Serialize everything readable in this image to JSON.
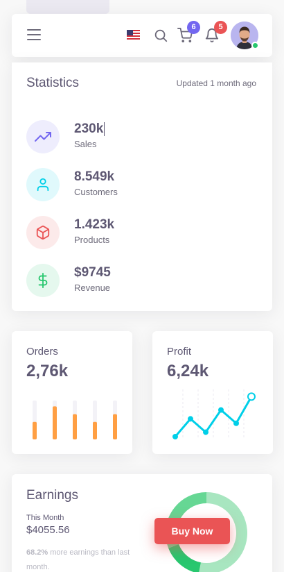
{
  "navbar": {
    "cart_count": "6",
    "notification_count": "5",
    "colors": {
      "cart_badge": "#7367f0",
      "notification_badge": "#ea5455",
      "online": "#28c76f"
    }
  },
  "statistics": {
    "title": "Statistics",
    "updated": "Updated 1 month ago",
    "items": [
      {
        "value": "230k",
        "label": "Sales",
        "icon": "trending-up-icon",
        "color": "#7367f0",
        "bg": "#eeedfd"
      },
      {
        "value": "8.549k",
        "label": "Customers",
        "icon": "user-icon",
        "color": "#00cfe8",
        "bg": "#e0f9fc"
      },
      {
        "value": "1.423k",
        "label": "Products",
        "icon": "box-icon",
        "color": "#ea5455",
        "bg": "#fceaea"
      },
      {
        "value": "$9745",
        "label": "Revenue",
        "icon": "dollar-icon",
        "color": "#28c76f",
        "bg": "#e5f8ee"
      }
    ]
  },
  "orders": {
    "title": "Orders",
    "value": "2,76k",
    "bar_levels": [
      0.45,
      0.85,
      0.65,
      0.45,
      0.65
    ],
    "colors": {
      "bar": "#ff9f43",
      "track": "#f3f2f7"
    }
  },
  "profit": {
    "title": "Profit",
    "value": "6,24k",
    "line_points": [
      0,
      20,
      5,
      30,
      15,
      45
    ],
    "line_max": 50,
    "color": "#00cfe8"
  },
  "earnings": {
    "title": "Earnings",
    "period": "This Month",
    "amount": "$4055.56",
    "percent": "68.2%",
    "note": " more earnings than last month.",
    "buy_label": "Buy Now",
    "donut": [
      {
        "share": 0.53,
        "color": "#a8e6c0"
      },
      {
        "share": 0.16,
        "color": "#28c76f"
      },
      {
        "share": 0.31,
        "color": "#66d794"
      }
    ]
  }
}
